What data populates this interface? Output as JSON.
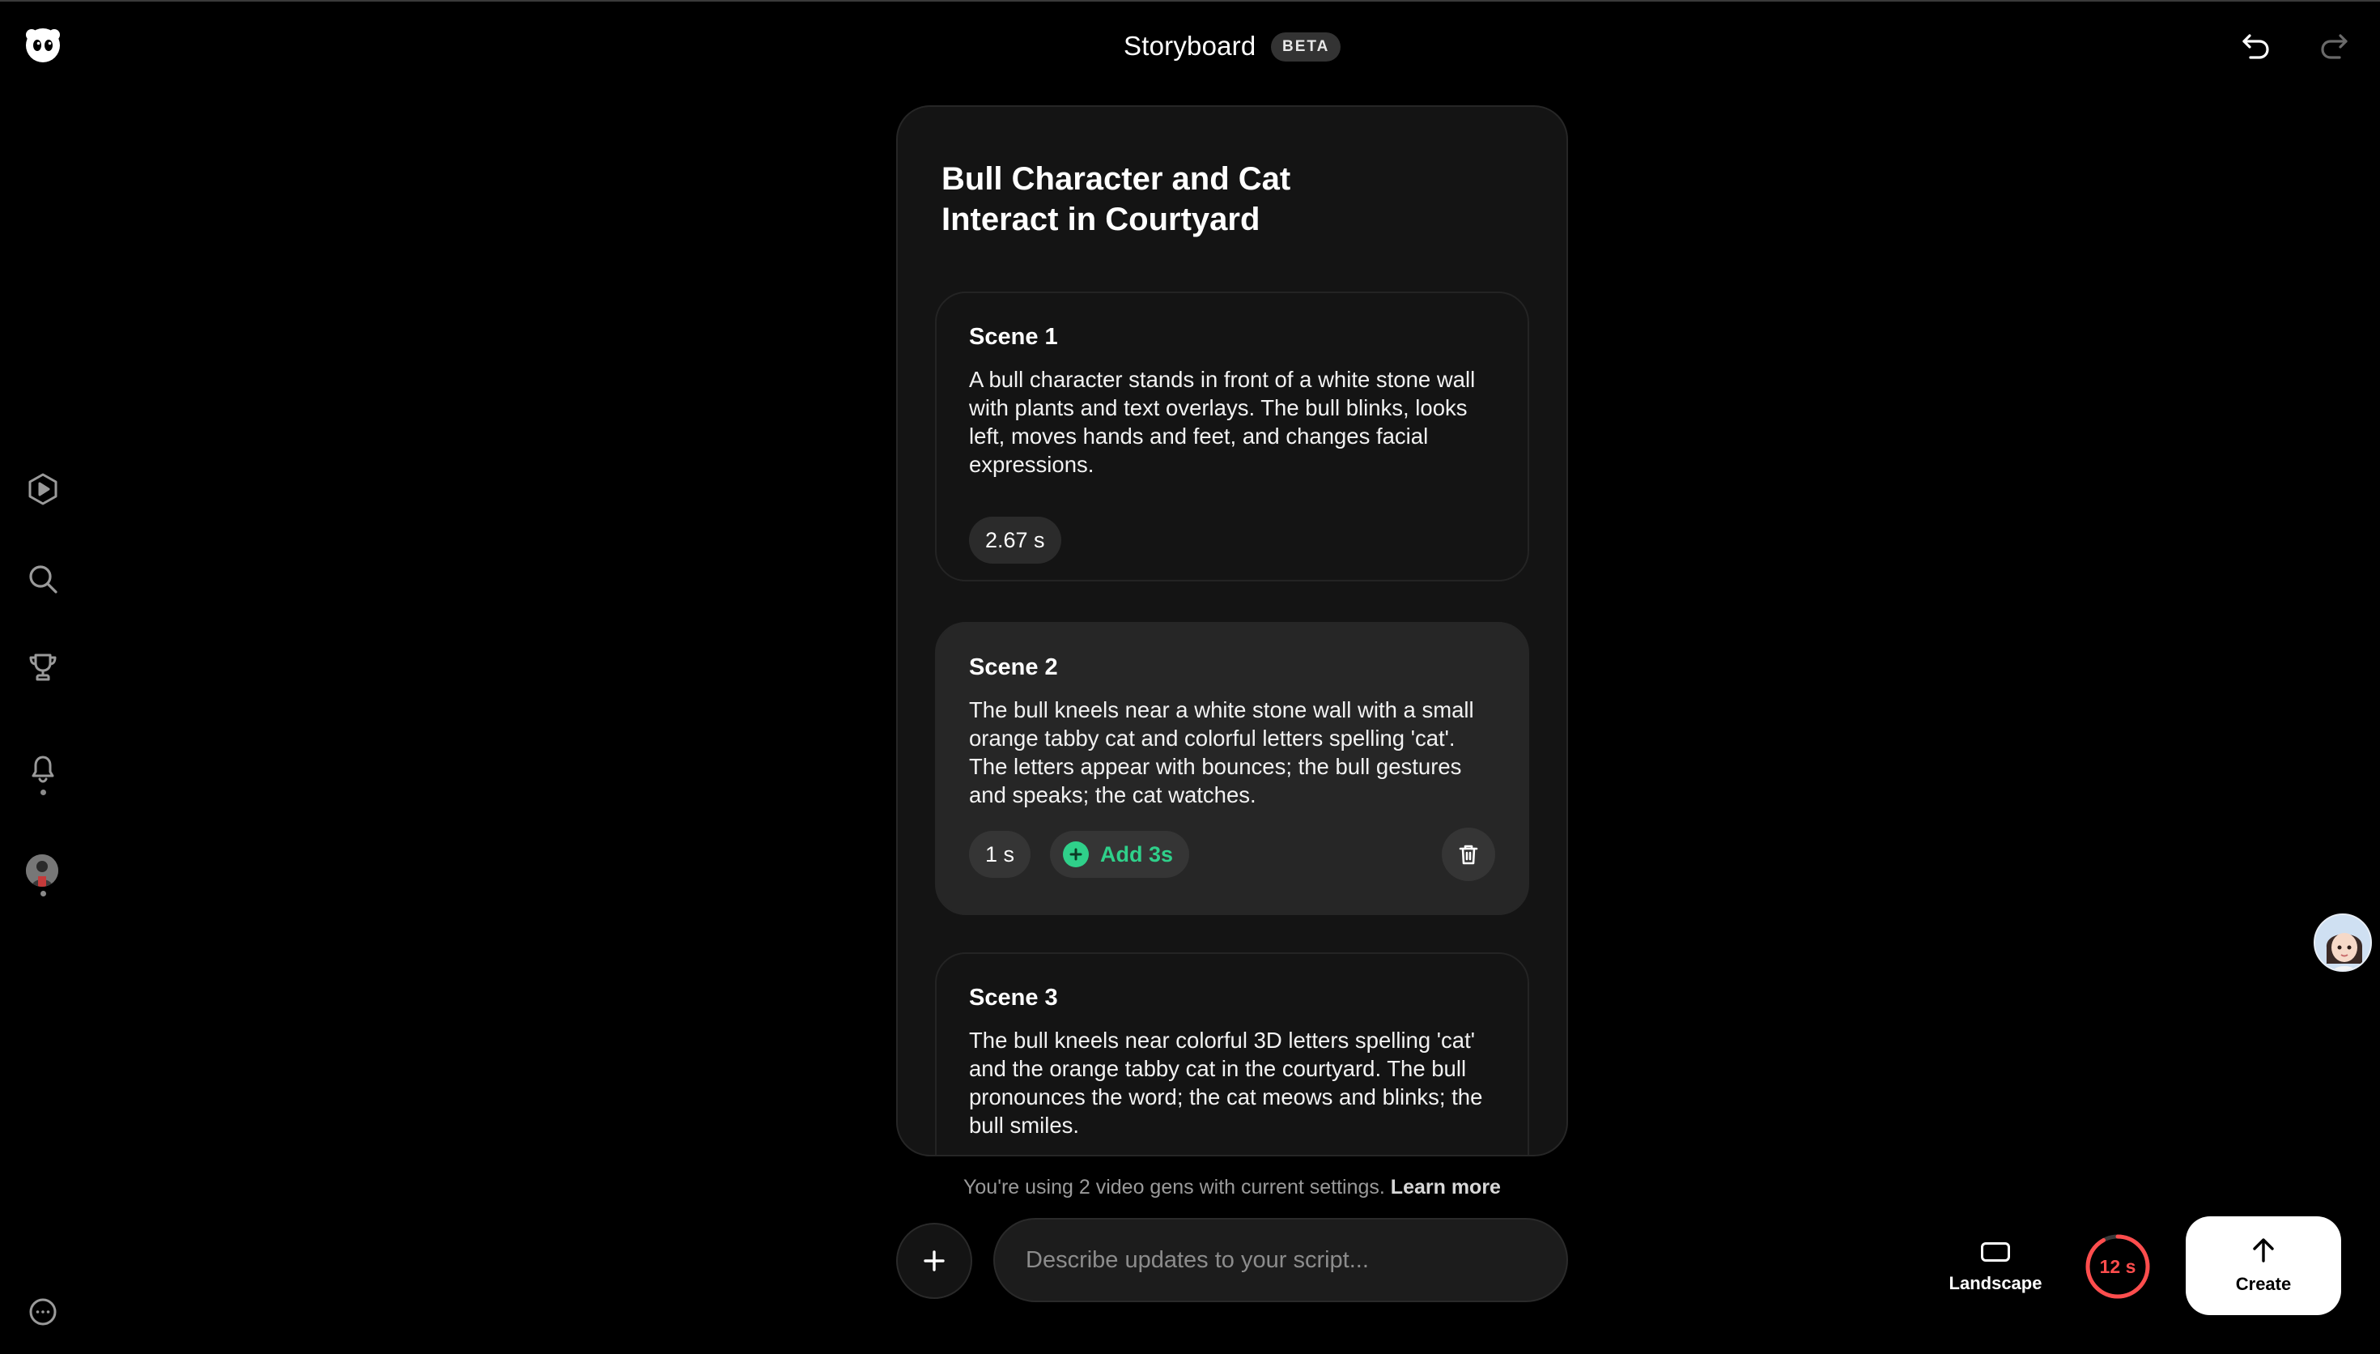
{
  "header": {
    "title": "Storyboard",
    "badge": "BETA"
  },
  "story": {
    "title": "Bull Character and Cat Interact in Courtyard",
    "scenes": [
      {
        "label": "Scene 1",
        "text": "A bull character stands in front of a white stone wall with plants and text overlays. The bull blinks, looks left, moves hands and feet, and changes facial expressions.",
        "duration": "2.67 s"
      },
      {
        "label": "Scene 2",
        "text": "The bull kneels near a white stone wall with a small orange tabby cat and colorful letters spelling 'cat'. The letters appear with bounces; the bull gestures and speaks; the cat watches.",
        "duration": "1 s",
        "add_label": "Add 3s"
      },
      {
        "label": "Scene 3",
        "text": "The bull kneels near colorful 3D letters spelling 'cat' and the orange tabby cat in the courtyard. The bull pronounces the word; the cat meows and blinks; the bull smiles."
      }
    ]
  },
  "usage": {
    "text": "You're using 2 video gens with current settings.",
    "link": "Learn more"
  },
  "composer": {
    "placeholder": "Describe updates to your script..."
  },
  "controls": {
    "orientation_label": "Landscape",
    "timer_label": "12 s",
    "timer_progress": 0.92,
    "create_label": "Create"
  },
  "colors": {
    "accent_green": "#2fd08a",
    "timer_red": "#ff4d4d"
  }
}
